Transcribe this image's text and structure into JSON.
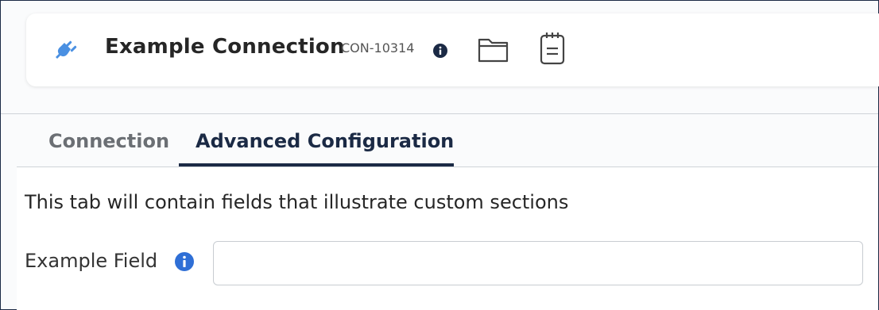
{
  "header": {
    "title": "Example Connection",
    "code": "CON-10314",
    "icons": {
      "plug": "plug-icon",
      "info": "info-icon",
      "folder": "folder-icon",
      "notes": "notepad-icon"
    }
  },
  "tabs": [
    {
      "label": "Connection",
      "active": false
    },
    {
      "label": "Advanced Configuration",
      "active": true
    }
  ],
  "content": {
    "description": "This tab will contain fields that illustrate custom sections",
    "field": {
      "label": "Example Field",
      "value": "",
      "placeholder": ""
    }
  },
  "colors": {
    "accent": "#1b2a45",
    "plug": "#4a90e2",
    "info_blue": "#2f6fd6"
  }
}
